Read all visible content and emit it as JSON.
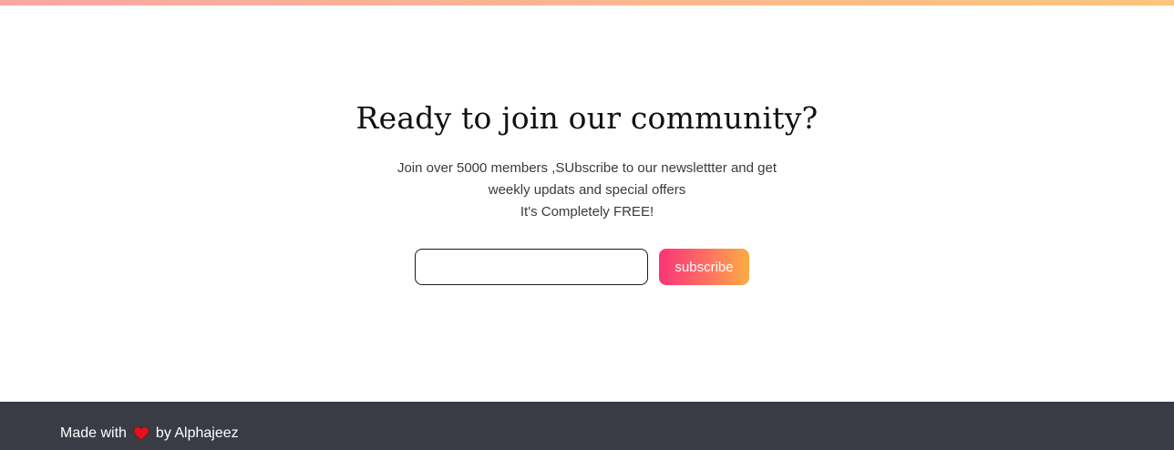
{
  "newsletter": {
    "heading": "Ready to join our community?",
    "description_line1": "Join over 5000 members ,SUbscribe to our newslettter and get",
    "description_line2": "weekly updats and special offers",
    "description_line3": "It's Completely FREE!",
    "email_input": {
      "value": "",
      "placeholder": ""
    },
    "subscribe_label": "subscribe"
  },
  "footer": {
    "made_with": "Made with",
    "heart_icon": "heart-icon",
    "by_author": "by Alphajeez"
  },
  "colors": {
    "top_bar_start": "#f9a7a3",
    "top_bar_end": "#fcc47c",
    "button_gradient_start": "#fb3478",
    "button_gradient_end": "#fdac45",
    "heart": "#e0141e",
    "footer_background": "#393c45"
  }
}
